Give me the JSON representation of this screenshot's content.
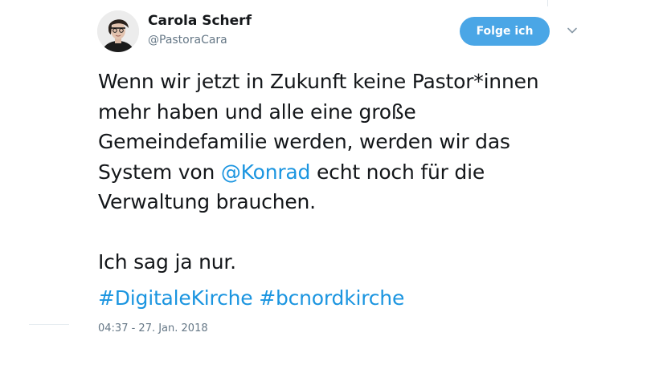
{
  "user": {
    "display_name": "Carola Scherf",
    "handle": "@PastoraCara"
  },
  "follow_button_label": "Folge ich",
  "menu_icon": "chevron-down-icon",
  "tweet": {
    "line1": "Wenn wir jetzt in Zukunft keine Pastor*innen",
    "line2": "mehr haben und alle eine große",
    "line3": "Gemeindefamilie werden, werden wir das",
    "line4_before": "System von ",
    "line4_mention": "@Konrad",
    "line4_after": " echt noch für die",
    "line5": "Verwaltung brauchen.",
    "line6": "Ich sag ja nur.",
    "hashtag1": "#DigitaleKirche",
    "hashtag2": "#bcnordkirche"
  },
  "timestamp": "04:37 - 27. Jan. 2018",
  "colors": {
    "follow_button": "#4aa6e6",
    "link": "#1b95e0",
    "secondary_text": "#657786"
  }
}
